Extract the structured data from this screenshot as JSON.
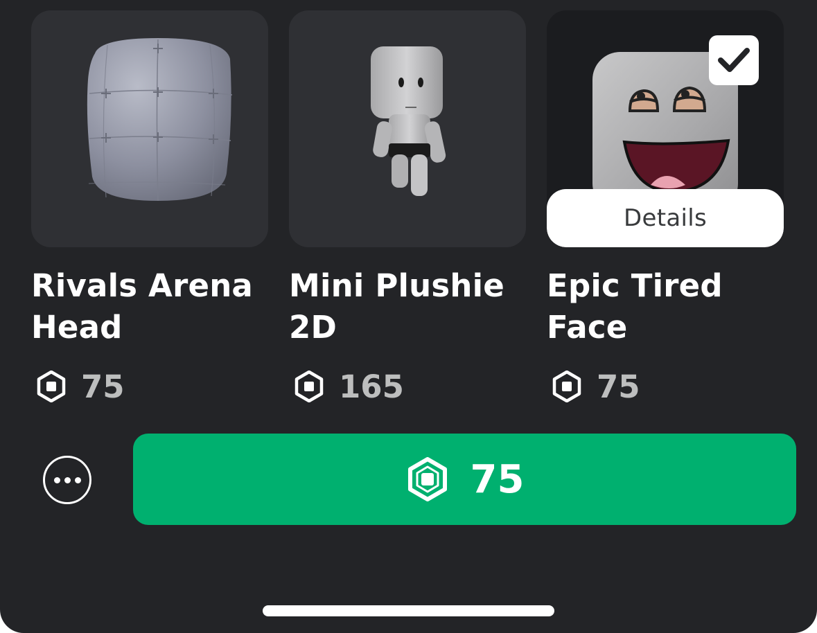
{
  "items": [
    {
      "name": "Rivals Arena Head",
      "price": "75",
      "image_icon": "gray-head-mesh-icon",
      "selected": false
    },
    {
      "name": "Mini Plushie 2D",
      "price": "165",
      "image_icon": "mini-plushie-avatar-icon",
      "selected": false
    },
    {
      "name": "Epic Tired Face",
      "price": "75",
      "image_icon": "epic-tired-face-icon",
      "selected": true,
      "details_label": "Details"
    }
  ],
  "purchase": {
    "price": "75",
    "currency_icon": "robux-icon",
    "more_icon": "more-options-icon"
  },
  "colors": {
    "background": "#232427",
    "card": "#2f3034",
    "buy_button": "#00b06f",
    "price_text": "#bdbebe"
  }
}
